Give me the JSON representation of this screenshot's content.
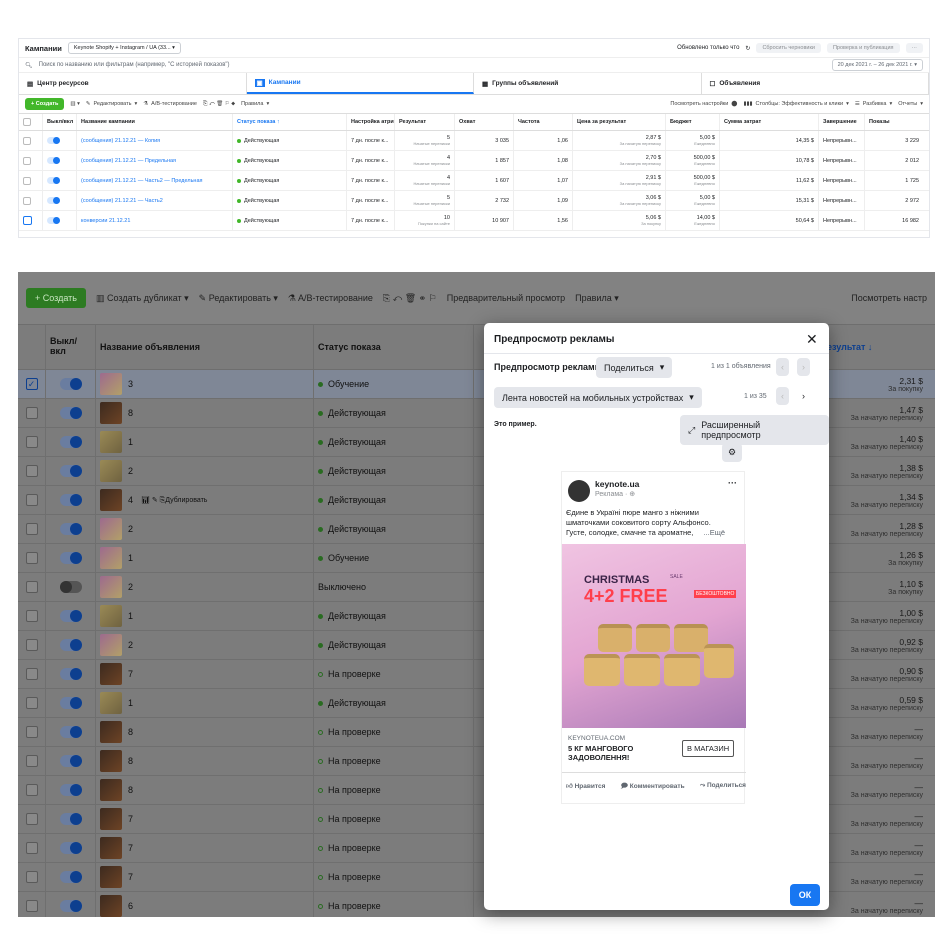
{
  "top": {
    "title": "Кампании",
    "account": "Keynote Shopify + Instagram / UA (33...",
    "updated": "Обновлено только что",
    "reset_drafts": "Сбросить черновики",
    "review_publish": "Проверка и публикация",
    "search_placeholder": "Поиск по названию или фильтрам (например, \"С историей показов\")",
    "date_range": "20 дек 2021 г. – 26 дек 2021 г.",
    "tabs": [
      "Центр ресурсов",
      "Кампании",
      "Группы объявлений",
      "Объявления"
    ],
    "toolbar": {
      "create": "+ Создать",
      "edit": "Редактировать",
      "ab": "A/B-тестирование",
      "rules": "Правила",
      "view_settings": "Посмотреть настройки",
      "columns": "Столбцы: Эффективность и клики",
      "breakdown": "Разбивка",
      "reports": "Отчеты"
    },
    "headers": [
      "Выкл/вкл",
      "Название кампании",
      "Статус показа ↑",
      "Настройка атрибуции",
      "Результат",
      "Охват",
      "Частота",
      "Цена за результат",
      "Бюджет",
      "Сумма затрат",
      "Завершение",
      "Показы"
    ],
    "rows": [
      {
        "name": "(сообщения) 21.12.21 — Копия",
        "status": "Действующая",
        "attr": "7 дн. после к...",
        "result": "5",
        "result_sub": "Начатые переписки",
        "reach": "3 035",
        "freq": "1,06",
        "cpr": "2,87 $",
        "cpr_sub": "За начатую переписку",
        "budget": "5,00 $",
        "budget_sub": "Ежедневно",
        "spent": "14,35 $",
        "end": "Непрерывн...",
        "impr": "3 229"
      },
      {
        "name": "(сообщения) 21.12.21 — Предельная",
        "status": "Действующая",
        "attr": "7 дн. после к...",
        "result": "4",
        "result_sub": "Начатые переписки",
        "reach": "1 857",
        "freq": "1,08",
        "cpr": "2,70 $",
        "cpr_sub": "За начатую переписку",
        "budget": "500,00 $",
        "budget_sub": "Ежедневно",
        "spent": "10,78 $",
        "end": "Непрерывн...",
        "impr": "2 012"
      },
      {
        "name": "(сообщения) 21.12.21 — Часть2 — Предельная",
        "status": "Действующая",
        "attr": "7 дн. после к...",
        "result": "4",
        "result_sub": "Начатые переписки",
        "reach": "1 607",
        "freq": "1,07",
        "cpr": "2,91 $",
        "cpr_sub": "За начатую переписку",
        "budget": "500,00 $",
        "budget_sub": "Ежедневно",
        "spent": "11,62 $",
        "end": "Непрерывн...",
        "impr": "1 725"
      },
      {
        "name": "(сообщения) 21.12.21 — Часть2",
        "status": "Действующая",
        "attr": "7 дн. после к...",
        "result": "5",
        "result_sub": "Начатые переписки",
        "reach": "2 732",
        "freq": "1,09",
        "cpr": "3,06 $",
        "cpr_sub": "За начатую переписку",
        "budget": "5,00 $",
        "budget_sub": "Ежедневно",
        "spent": "15,31 $",
        "end": "Непрерывн...",
        "impr": "2 972"
      },
      {
        "name": "конверсии 21.12.21",
        "status": "Действующая",
        "attr": "7 дн. после к...",
        "result": "10",
        "result_sub": "Покупки на сайте",
        "reach": "10 907",
        "freq": "1,56",
        "cpr": "5,06 $",
        "cpr_sub": "За покупку",
        "budget": "14,00 $",
        "budget_sub": "Ежедневно",
        "spent": "50,64 $",
        "end": "Непрерывн...",
        "impr": "16 982"
      }
    ]
  },
  "bottom": {
    "toolbar": {
      "create": "+ Создать",
      "duplicate": "Создать дубликат",
      "edit": "Редактировать",
      "ab": "A/B-тестирование",
      "preview": "Предварительный просмотр",
      "rules": "Правила",
      "view": "Посмотреть настр"
    },
    "headers": {
      "toggle": "Выкл/вкл",
      "name": "Название объявления",
      "status": "Статус показа",
      "cpr": "а результат ↓"
    },
    "duplicate_inline": "Дублировать",
    "rows": [
      {
        "n": "3",
        "t": "t1",
        "status": "Обучение",
        "st": "learn",
        "v": "2,31 $",
        "s": "За покупку"
      },
      {
        "n": "8",
        "t": "t2",
        "status": "Действующая",
        "st": "on",
        "v": "1,47 $",
        "s": "За начатую переписку"
      },
      {
        "n": "1",
        "t": "t3",
        "status": "Действующая",
        "st": "on",
        "v": "1,40 $",
        "s": "За начатую переписку"
      },
      {
        "n": "2",
        "t": "t3",
        "status": "Действующая",
        "st": "on",
        "v": "1,38 $",
        "s": "За начатую переписку"
      },
      {
        "n": "4",
        "t": "t2",
        "status": "Действующая",
        "st": "on",
        "v": "1,34 $",
        "s": "За начатую переписку"
      },
      {
        "n": "2",
        "t": "t1",
        "status": "Действующая",
        "st": "on",
        "v": "1,28 $",
        "s": "За начатую переписку"
      },
      {
        "n": "1",
        "t": "t1",
        "status": "Обучение",
        "st": "learn",
        "v": "1,26 $",
        "s": "За покупку"
      },
      {
        "n": "2",
        "t": "t1",
        "status": "Выключено",
        "st": "off",
        "v": "1,10 $",
        "s": "За покупку"
      },
      {
        "n": "1",
        "t": "t3",
        "status": "Действующая",
        "st": "on",
        "v": "1,00 $",
        "s": "За начатую переписку"
      },
      {
        "n": "2",
        "t": "t1",
        "status": "Действующая",
        "st": "on",
        "v": "0,92 $",
        "s": "За начатую переписку"
      },
      {
        "n": "7",
        "t": "t2",
        "status": "На проверке",
        "st": "rev",
        "v": "0,90 $",
        "s": "За начатую переписку"
      },
      {
        "n": "1",
        "t": "t3",
        "status": "Действующая",
        "st": "on",
        "v": "0,59 $",
        "s": "За начатую переписку"
      },
      {
        "n": "8",
        "t": "t2",
        "status": "На проверке",
        "st": "rev",
        "v": "—",
        "s": "За начатую переписку"
      },
      {
        "n": "8",
        "t": "t2",
        "status": "На проверке",
        "st": "rev",
        "v": "—",
        "s": "За начатую переписку"
      },
      {
        "n": "8",
        "t": "t2",
        "status": "На проверке",
        "st": "rev",
        "v": "—",
        "s": "За начатую переписку"
      },
      {
        "n": "7",
        "t": "t2",
        "status": "На проверке",
        "st": "rev",
        "v": "—",
        "s": "За начатую переписку"
      },
      {
        "n": "7",
        "t": "t2",
        "status": "На проверке",
        "st": "rev",
        "v": "—",
        "s": "За начатую переписку"
      },
      {
        "n": "7",
        "t": "t2",
        "status": "На проверке",
        "st": "rev",
        "v": "—",
        "s": "За начатую переписку"
      },
      {
        "n": "6",
        "t": "t2",
        "status": "На проверке",
        "st": "rev",
        "v": "—",
        "s": "За начатую переписку"
      }
    ]
  },
  "modal": {
    "title": "Предпросмотр рекламы",
    "subtitle": "Предпросмотр рекламы",
    "share": "Поделиться",
    "count": "1 из 1 объявления",
    "placement": "Лента новостей на мобильных устройствах",
    "placement_count": "1 из 35",
    "example": "Это пример.",
    "advanced": "Расширенный предпросмотр",
    "ok": "ОК",
    "ad": {
      "page": "keynote.ua",
      "sponsored": "Реклама · ⊕",
      "text1": "Єдине в Україні пюре манго з ніжними",
      "text2": "шматочками соковитого сорту Альфонсо.",
      "text3": "Густе, солодке, смачне та ароматне,",
      "more": "...Ещё",
      "img_title": "CHRISTMAS",
      "img_sale": "SALE",
      "img_offer": "4+2 FREE",
      "img_badge": "БЕЗКОШТОВНО",
      "domain": "KEYNOTEUA.COM",
      "headline1": "5 КГ МАНГОВОГО",
      "headline2": "ЗАДОВОЛЕННЯ!",
      "cta": "В МАГАЗИН",
      "like": "Нравится",
      "comment": "Комментировать",
      "share": "Поделиться"
    }
  }
}
